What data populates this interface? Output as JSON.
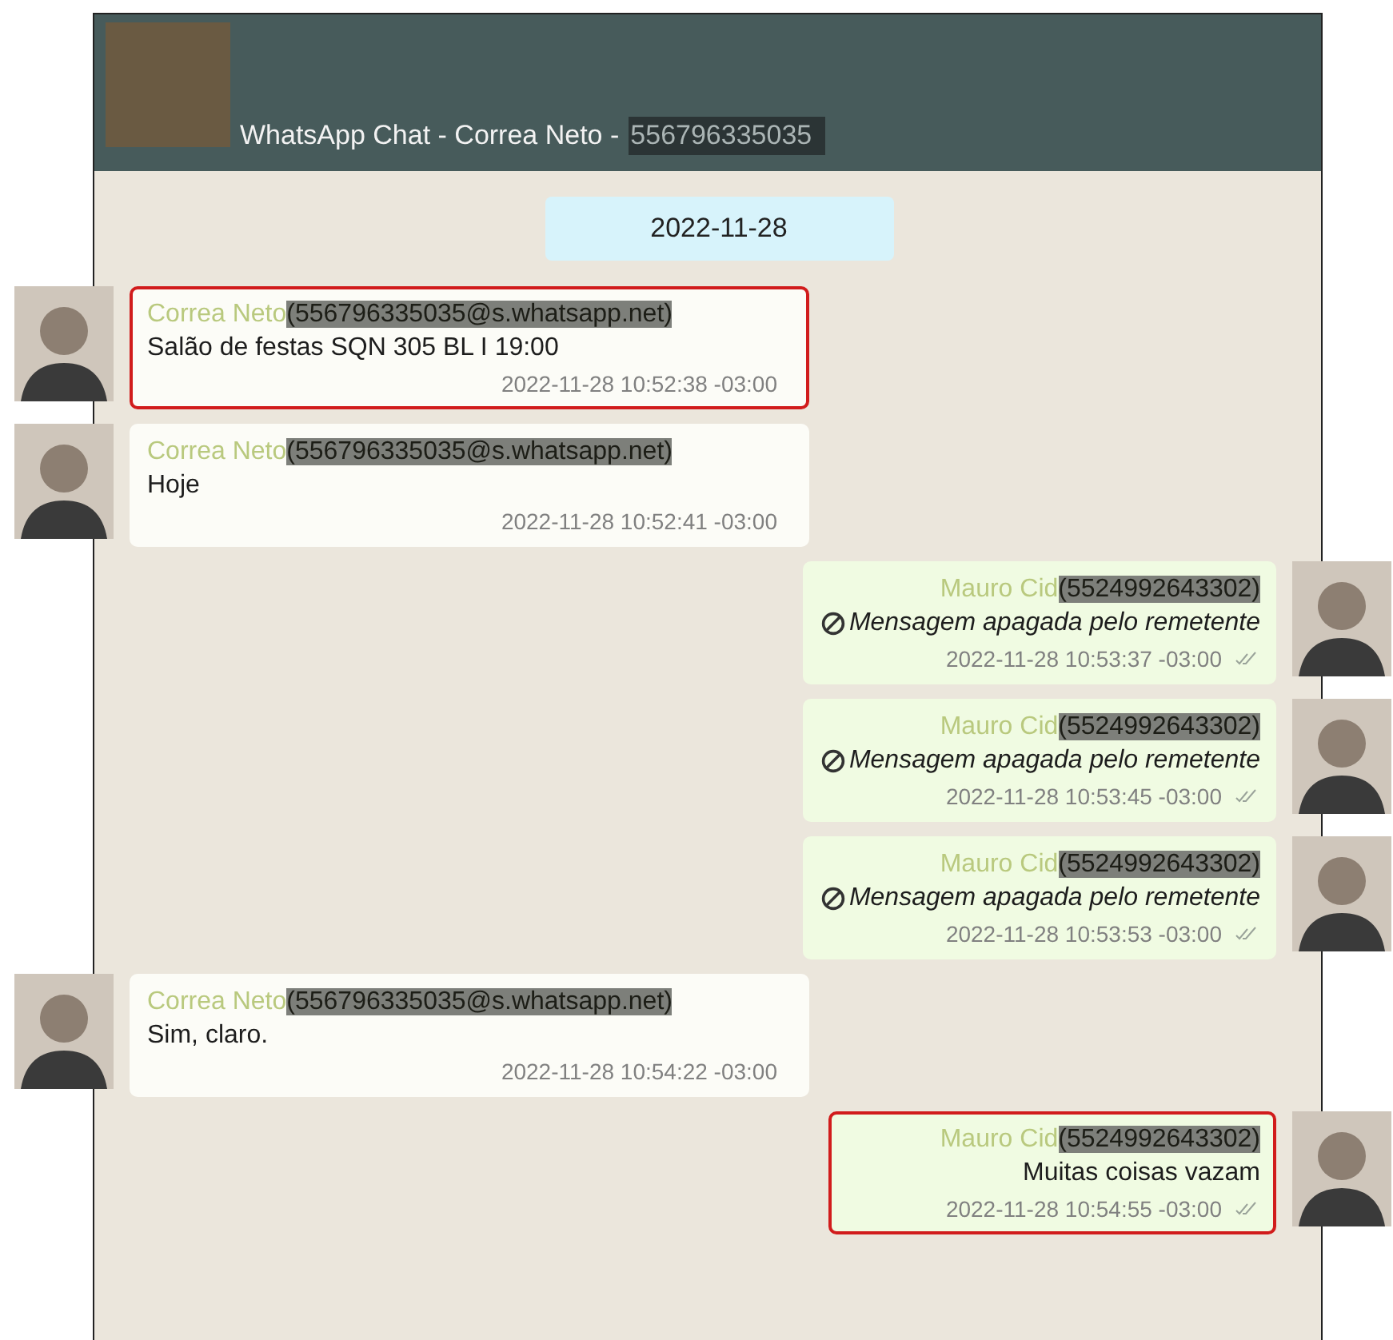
{
  "header": {
    "title": "WhatsApp Chat - Correa Neto -",
    "phone": "556796335035",
    "phone_redacted": true
  },
  "date_chip": "2022-11-28",
  "messages": [
    {
      "outgoing": false,
      "sender": "Correa Neto",
      "sender_id": "(556796335035@s.whatsapp.net)",
      "id_redacted": true,
      "kind": "text",
      "text": "Salão de festas SQN 305 BL I 19:00",
      "time": "2022-11-28 10:52:38 -03:00",
      "highlighted": true
    },
    {
      "outgoing": false,
      "sender": "Correa Neto",
      "sender_id": "(556796335035@s.whatsapp.net)",
      "id_redacted": true,
      "kind": "text",
      "text": "Hoje",
      "time": "2022-11-28 10:52:41 -03:00",
      "highlighted": false
    },
    {
      "outgoing": true,
      "sender": "Mauro Cid",
      "sender_id": "(5524992643302)",
      "id_redacted": true,
      "kind": "deleted",
      "text": "Mensagem apagada pelo remetente",
      "time": "2022-11-28 10:53:37 -03:00",
      "highlighted": false
    },
    {
      "outgoing": true,
      "sender": "Mauro Cid",
      "sender_id": "(5524992643302)",
      "id_redacted": true,
      "kind": "deleted",
      "text": "Mensagem apagada pelo remetente",
      "time": "2022-11-28 10:53:45 -03:00",
      "highlighted": false
    },
    {
      "outgoing": true,
      "sender": "Mauro Cid",
      "sender_id": "(5524992643302)",
      "id_redacted": true,
      "kind": "deleted",
      "text": "Mensagem apagada pelo remetente",
      "time": "2022-11-28 10:53:53 -03:00",
      "highlighted": false
    },
    {
      "outgoing": false,
      "sender": "Correa Neto",
      "sender_id": "(556796335035@s.whatsapp.net)",
      "id_redacted": true,
      "kind": "text",
      "text": "Sim, claro.",
      "time": "2022-11-28 10:54:22 -03:00",
      "highlighted": false
    },
    {
      "outgoing": true,
      "sender": "Mauro Cid",
      "sender_id": "(5524992643302)",
      "id_redacted": true,
      "kind": "text",
      "text": "Muitas coisas vazam",
      "time": "2022-11-28 10:54:55 -03:00",
      "highlighted": true
    }
  ]
}
